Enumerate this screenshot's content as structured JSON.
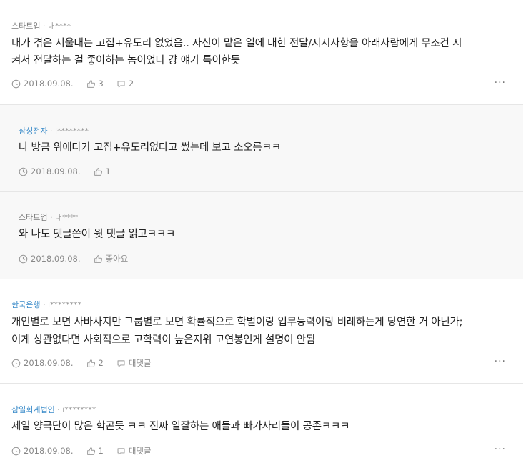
{
  "comments": [
    {
      "company": "스타트업",
      "author": "내****",
      "lines": [
        "내가 겪은 서울대는 고집+유도리 없었음.. 자신이 맡은 일에 대한 전달/지시사항을 아래사람에게 무조건 시",
        "켜서 전달하는 걸 좋아하는 놈이었다 걍 얘가 특이한듯"
      ],
      "date": "2018.09.08.",
      "likes": "3",
      "replies": "2",
      "more": "···"
    },
    {
      "company": "삼성전자",
      "author": "i********",
      "lines": [
        "나 방금 위에다가 고집+유도리없다고 썼는데 보고 소오름ㅋㅋ"
      ],
      "date": "2018.09.08.",
      "likes": "1"
    },
    {
      "company": "스타트업",
      "author": "내****",
      "lines": [
        "와 나도 댓글쓴이 윗 댓글 읽고ㅋㅋㅋ"
      ],
      "date": "2018.09.08.",
      "likes": "좋아요"
    },
    {
      "company": "한국은행",
      "author": "i********",
      "lines": [
        "개인별로 보면 사바사지만 그룹별로 보면 확률적으로 학벌이랑 업무능력이랑 비례하는게 당연한 거 아닌가;",
        "이게 상관없다면 사회적으로 고학력이 높은지위 고연봉인게 설명이 안됨"
      ],
      "date": "2018.09.08.",
      "likes": "2",
      "replies": "대댓글",
      "more": "···"
    },
    {
      "company": "삼일회계법인",
      "author": "i********",
      "lines": [
        "제일 양극단이 많은 학곤듯 ㅋㅋ 진짜 일잘하는 애들과 빠가사리들이 공존ㅋㅋㅋ"
      ],
      "date": "2018.09.08.",
      "likes": "1",
      "replies": "대댓글",
      "more": "···"
    }
  ],
  "meta_separator": "·"
}
